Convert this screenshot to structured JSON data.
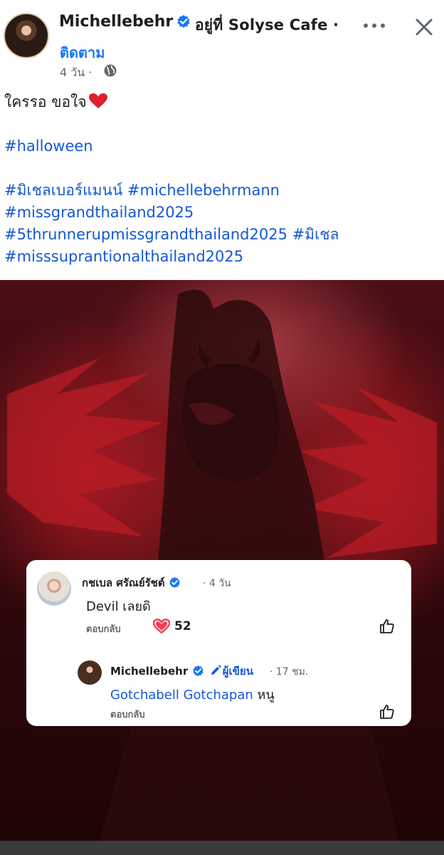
{
  "post": {
    "author": "Michellebehr",
    "place": "อยู่ที่ Solyse Cafe ·",
    "follow_label": "ติดตาม",
    "time": "4 วัน ·",
    "caption": {
      "line1": "ใครรอ ขอใจ",
      "hashtags_line1": "#halloween",
      "hashtags_line2a": "#มิเชลเบอร์แมนน์",
      "hashtags_line2b": "#michellebehrmann",
      "hashtags_line3": "#missgrandthailand2025",
      "hashtags_line4a": "#5thrunnerupmissgrandthailand2025",
      "hashtags_line4b": "#มิเชล",
      "hashtags_line5": "#misssuprantionalthailand2025"
    }
  },
  "comments": [
    {
      "name": "กชเบล ศรัณย์รัชต์",
      "time": "· 4 วัน",
      "text": "Devil เลยดิ",
      "reply_label": "ตอบกลับ",
      "reactions": "52"
    },
    {
      "name": "Michellebehr",
      "badge": "ผู้เขียน",
      "time": "· 17 ชม.",
      "mention": "Gotchabell Gotchapan",
      "text": "หนู",
      "reply_label": "ตอบกลับ"
    }
  ],
  "colors": {
    "link": "#1558d6",
    "accent": "#1877f2",
    "heart": "#f33e58"
  },
  "icons": [
    "verified-icon",
    "more-icon",
    "close-icon",
    "globe-icon",
    "heart-emoji-icon",
    "like-icon",
    "heart-reaction-icon",
    "pen-icon"
  ]
}
